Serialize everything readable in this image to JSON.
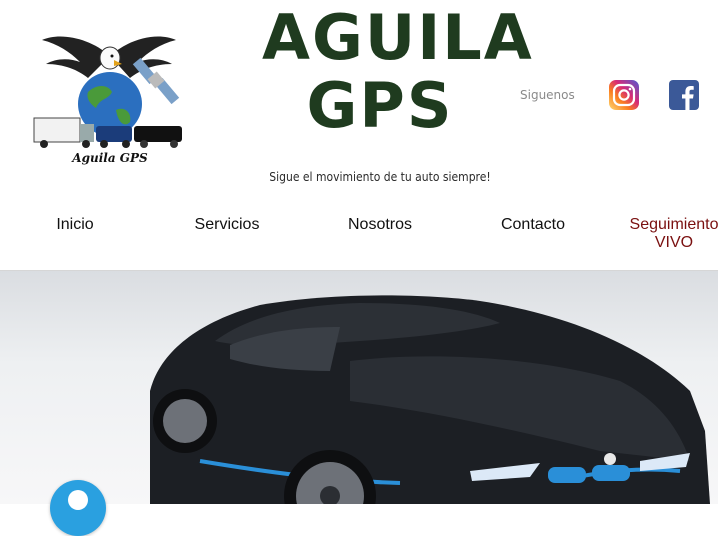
{
  "header": {
    "brand_line1": "AGUILA",
    "brand_line2": "GPS",
    "tagline": "Sigue el movimiento de tu auto siempre!",
    "logo_caption": "Aguila GPS",
    "follow_label": "Siguenos"
  },
  "social": [
    {
      "name": "instagram-icon",
      "color": "#d62976"
    },
    {
      "name": "facebook-icon",
      "color": "#3b5998"
    }
  ],
  "nav": {
    "items": [
      "Inicio",
      "Servicios",
      "Nosotros",
      "Contacto"
    ],
    "live_line1": "Seguimiento",
    "live_line2": "VIVO"
  },
  "colors": {
    "brand_green": "#1f3b1f",
    "brand_orange": "#c9752e",
    "live_link": "#7a1010",
    "chat_blue": "#2aa0e0"
  }
}
